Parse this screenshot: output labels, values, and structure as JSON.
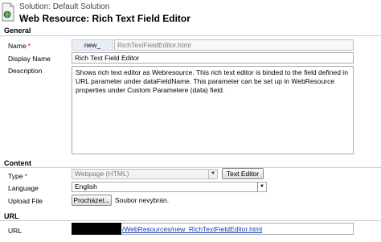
{
  "header": {
    "solution": "Solution: Default Solution",
    "title": "Web Resource: Rich Text Field Editor"
  },
  "general": {
    "section_title": "General",
    "name_label": "Name",
    "required_marker": "*",
    "name_prefix": "new_",
    "name_value": "RichTextFieldEditor.html",
    "display_name_label": "Display Name",
    "display_name_value": "Rich Text Field Editor",
    "description_label": "Description",
    "description_value": "Shows rich text editor as Webresource. This rich text editor is binded to the field defined in URL parameter under dataFieldName. This parameter can be set up in WebResource properties under Custom Parametere (data) field."
  },
  "content": {
    "section_title": "Content",
    "type_label": "Type",
    "type_value": "Webpage (HTML)",
    "text_editor_button": "Text Editor",
    "language_label": "Language",
    "language_value": "English",
    "upload_label": "Upload File",
    "browse_button": "Procházet...",
    "file_status": "Soubor nevybrán."
  },
  "url": {
    "section_title": "URL",
    "url_label": "URL",
    "url_value": "/WebResources/new_RichTextFieldEditor.html"
  },
  "icons": {
    "document": "document-icon",
    "dropdown": "chevron-down-icon"
  },
  "colors": {
    "required": "#e00000",
    "link": "#1a3cb5",
    "prefix_bg": "#e9eef6"
  }
}
